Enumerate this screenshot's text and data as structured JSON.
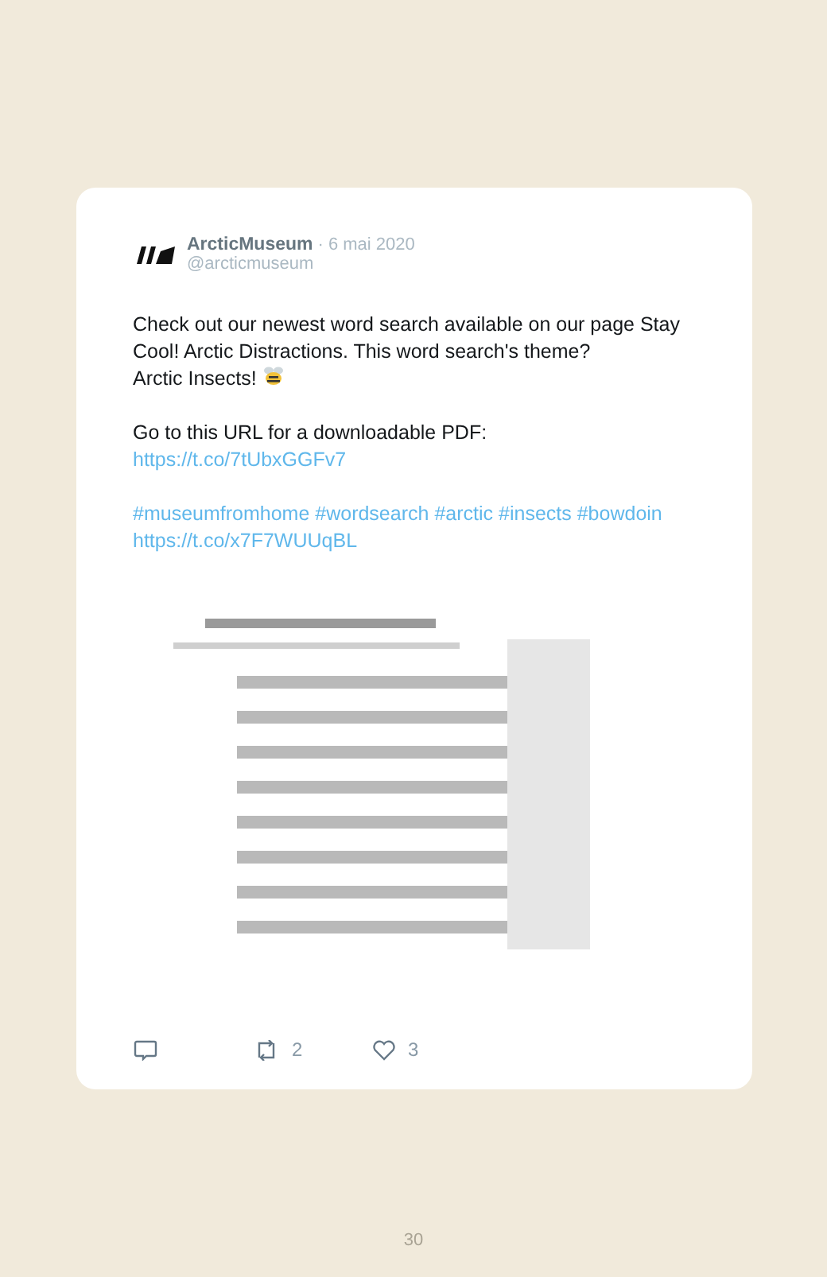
{
  "tweet": {
    "author": "ArcticMuseum",
    "date": "· 6 mai 2020",
    "handle": "@arcticmuseum",
    "paragraphs": [
      [
        {
          "kind": "text",
          "text": "Check out our newest word search available on our page Stay Cool! Arctic Distractions. This word search's theme?"
        },
        {
          "kind": "text",
          "text": "Arctic Insects!"
        }
      ],
      [
        {
          "kind": "text",
          "text": "Go to this URL for a downloadable PDF:"
        },
        {
          "kind": "link",
          "text": "https://t.co/7tUbxGGFv7"
        }
      ],
      [
        {
          "kind": "link",
          "text": "#museumfromhome"
        },
        {
          "kind": "link",
          "text": "#wordsearch"
        },
        {
          "kind": "link",
          "text": "#arctic"
        },
        {
          "kind": "link",
          "text": "#insects"
        },
        {
          "kind": "link",
          "text": "#bowdoin"
        },
        {
          "kind": "link",
          "text": "https://t.co/x7F7WUUqBL"
        }
      ]
    ],
    "media": {
      "kind": "picture"
    },
    "actions": [
      {
        "kind": "reply"
      },
      {
        "kind": "retweet",
        "count": "2"
      },
      {
        "kind": "like",
        "count": "3"
      }
    ]
  },
  "page_number": "30"
}
